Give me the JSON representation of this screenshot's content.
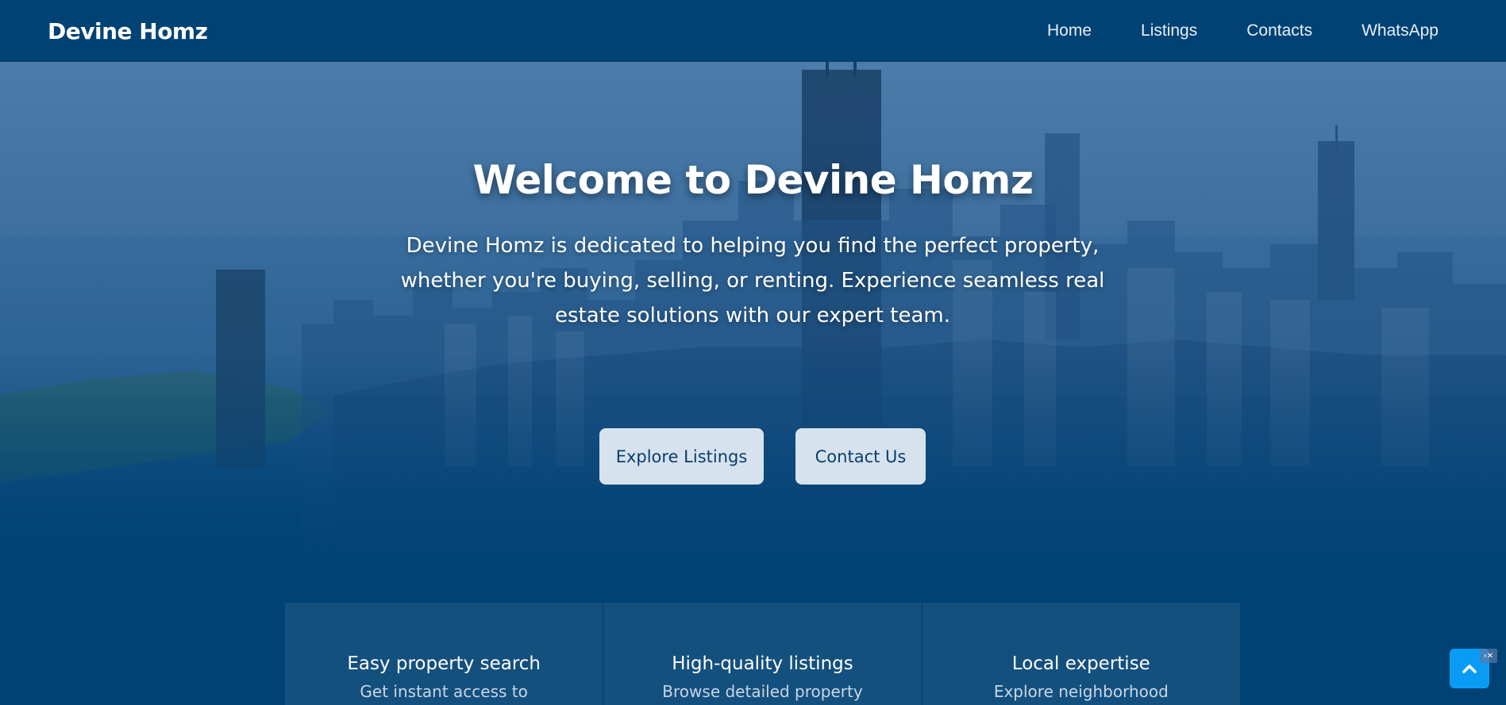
{
  "navbar": {
    "brand": "Devine Homz",
    "links": [
      "Home",
      "Listings",
      "Contacts",
      "WhatsApp"
    ]
  },
  "hero": {
    "title": "Welcome to Devine Homz",
    "description": "Devine Homz is dedicated to helping you find the perfect property, whether you're buying, selling, or renting. Experience seamless real estate solutions with our expert team.",
    "buttons": {
      "explore": "Explore Listings",
      "contact": "Contact Us"
    }
  },
  "features": [
    {
      "title": "Easy property search",
      "desc": "Get instant access to"
    },
    {
      "title": "High-quality listings",
      "desc": "Browse detailed property"
    },
    {
      "title": "Local expertise",
      "desc": "Explore neighborhood"
    }
  ],
  "colors": {
    "primary": "#004274",
    "button_bg": "#d6e2ee",
    "button_text": "#0a3d6b",
    "scroll_top": "#0a9cf5"
  },
  "icons": {
    "scroll_top": "chevron-up-icon",
    "ad_badge": "close-icon"
  },
  "ad_badge_text": "›✕"
}
